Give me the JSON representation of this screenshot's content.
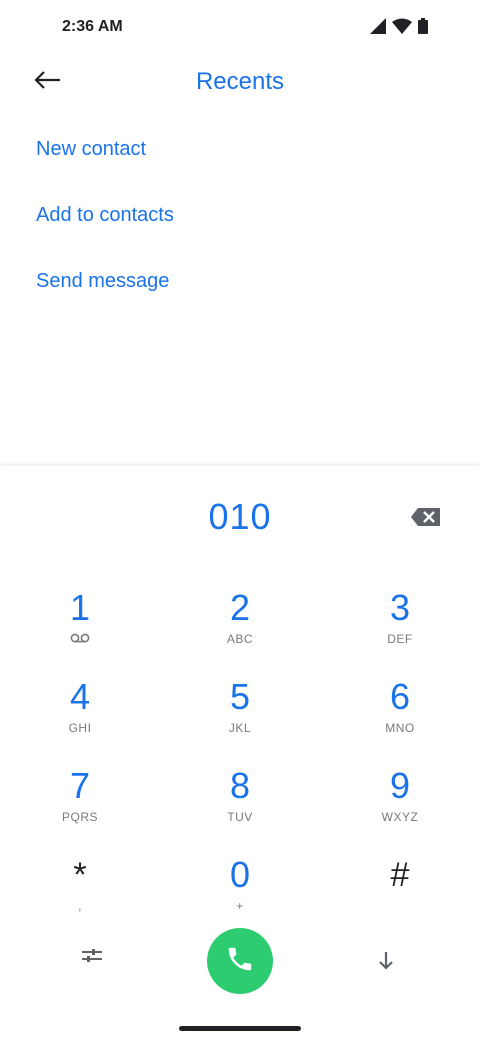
{
  "status": {
    "time": "2:36 AM"
  },
  "appbar": {
    "title": "Recents"
  },
  "actions": [
    {
      "label": "New contact"
    },
    {
      "label": "Add to contacts"
    },
    {
      "label": "Send message"
    }
  ],
  "dialer": {
    "number": "010",
    "keys": [
      {
        "digit": "1",
        "letters": ""
      },
      {
        "digit": "2",
        "letters": "ABC"
      },
      {
        "digit": "3",
        "letters": "DEF"
      },
      {
        "digit": "4",
        "letters": "GHI"
      },
      {
        "digit": "5",
        "letters": "JKL"
      },
      {
        "digit": "6",
        "letters": "MNO"
      },
      {
        "digit": "7",
        "letters": "PQRS"
      },
      {
        "digit": "8",
        "letters": "TUV"
      },
      {
        "digit": "9",
        "letters": "WXYZ"
      },
      {
        "digit": "*",
        "letters": ","
      },
      {
        "digit": "0",
        "letters": "+"
      },
      {
        "digit": "#",
        "letters": ""
      }
    ]
  },
  "colors": {
    "accent": "#1a73e8",
    "call": "#2ecc71"
  },
  "icons": {
    "status": [
      "signal-icon",
      "wifi-icon",
      "battery-icon"
    ],
    "back": "back-arrow-icon",
    "backspace": "backspace-icon",
    "voicemail": "voicemail-icon",
    "call": "phone-icon",
    "settings": "dialpad-settings-icon",
    "collapse": "arrow-down-icon"
  }
}
